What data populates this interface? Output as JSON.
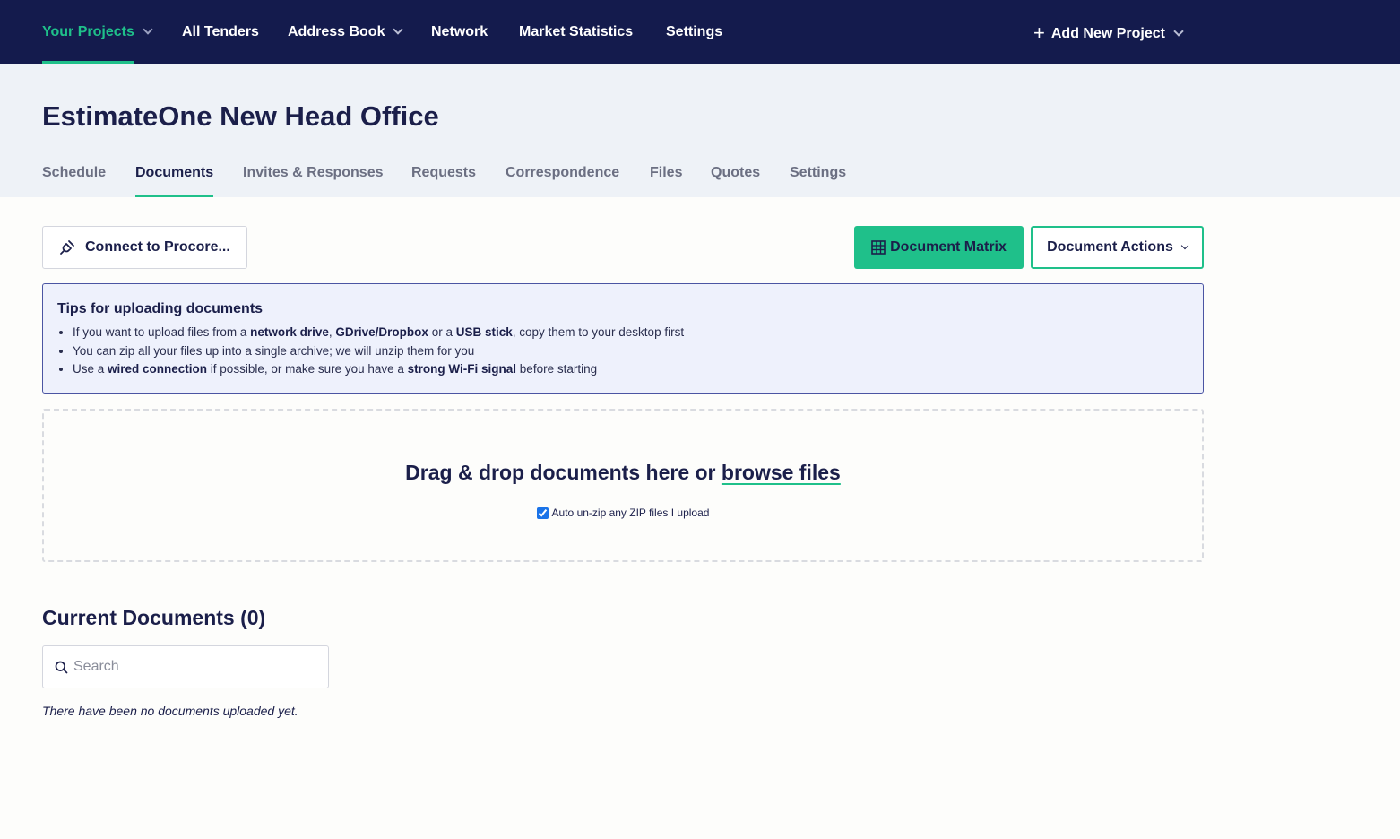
{
  "topnav": {
    "items": [
      {
        "label": "Your Projects",
        "active": true,
        "dropdown": true
      },
      {
        "label": "All Tenders"
      },
      {
        "label": "Address Book",
        "dropdown": true
      },
      {
        "label": "Network"
      },
      {
        "label": "Market Statistics"
      },
      {
        "label": "Settings"
      }
    ],
    "add_project_label": "Add New Project"
  },
  "project": {
    "title": "EstimateOne New Head Office",
    "tabs": [
      {
        "label": "Schedule"
      },
      {
        "label": "Documents",
        "active": true
      },
      {
        "label": "Invites & Responses"
      },
      {
        "label": "Requests"
      },
      {
        "label": "Correspondence"
      },
      {
        "label": "Files"
      },
      {
        "label": "Quotes"
      },
      {
        "label": "Settings"
      }
    ]
  },
  "toolbar": {
    "procore_label": "Connect to Procore...",
    "matrix_label": "Document Matrix",
    "actions_label": "Document Actions"
  },
  "tips": {
    "title": "Tips for uploading documents",
    "line1": {
      "a": "If you want to upload files from a ",
      "b1": "network drive",
      "c": ", ",
      "b2": "GDrive/Dropbox",
      "d": " or a ",
      "b3": "USB stick",
      "e": ", copy them to your desktop first"
    },
    "line2": "You can zip all your files up into a single archive; we will unzip them for you",
    "line3": {
      "a": "Use a ",
      "b1": "wired connection",
      "c": " if possible, or make sure you have a ",
      "b2": "strong Wi-Fi signal",
      "d": " before starting"
    }
  },
  "dropzone": {
    "text": "Drag & drop documents here or ",
    "link": "browse files",
    "auto_unzip_label": "Auto un-zip any ZIP files I upload",
    "auto_unzip_checked": true
  },
  "documents": {
    "heading": "Current Documents (0)",
    "search_placeholder": "Search",
    "empty_message": "There have been no documents uploaded yet."
  },
  "colors": {
    "nav_bg": "#141b4d",
    "accent": "#1fc08a",
    "header_band": "#eef2f7",
    "tips_bg": "#eef1fc",
    "tips_border": "#4b55a3"
  }
}
